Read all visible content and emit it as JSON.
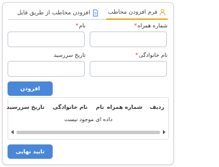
{
  "tabs": [
    {
      "label": "فرم افزودن مخاطب",
      "icon": "user-icon",
      "active": true
    },
    {
      "label": "افزودن مخاطب از طریق فایل",
      "icon": "file-icon",
      "active": false
    }
  ],
  "form": {
    "mobile_label": "شماره همراه",
    "name_label": "نام",
    "lastname_label": "نام خانوادگی",
    "due_date_label": "تاریخ سررسید",
    "required_mark": "*",
    "mobile_value": "",
    "name_value": "",
    "lastname_value": "",
    "due_date_value": "",
    "add_button": "افزودن"
  },
  "table": {
    "columns": [
      "ردیف",
      "شماره همراه",
      "نام",
      "نام خانوادگی",
      "تاریخ سررسید"
    ],
    "empty_message": "داده ای موجود نیست"
  },
  "footer": {
    "confirm_button": "تایید نهایی"
  },
  "colors": {
    "accent": "#4a87d8",
    "active_tab_underline": "#e6a817",
    "required": "#d43b3b"
  }
}
